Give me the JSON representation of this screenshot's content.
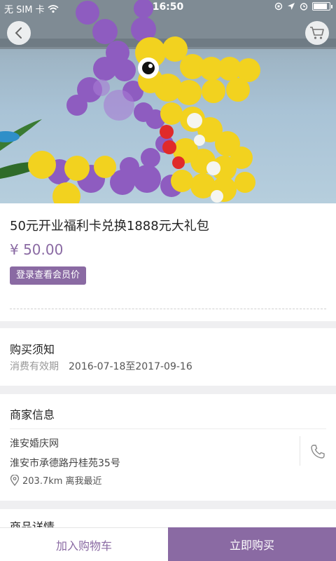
{
  "status_bar": {
    "carrier": "无 SIM 卡",
    "time": "16:50",
    "battery_level": 0.9
  },
  "header": {
    "back_icon": "chevron-left-icon",
    "cart_icon": "shopping-cart-icon"
  },
  "hero": {
    "image": "balloon-giraffe-photo"
  },
  "product": {
    "title": "50元开业福利卡兑换1888元大礼包",
    "price": "¥ 50.00",
    "member_price_button": "登录查看会员价"
  },
  "purchase_notice": {
    "title": "购买须知",
    "validity_label": "消费有效期",
    "validity_value": "2016-07-18至2017-09-16"
  },
  "merchant": {
    "title": "商家信息",
    "name": "淮安婚庆网",
    "address": "淮安市承德路丹桂苑35号",
    "distance": "203.7km 离我最近",
    "location_icon": "location-pin-icon",
    "phone_icon": "phone-icon"
  },
  "details": {
    "title": "商品详情"
  },
  "bottom_bar": {
    "add_to_cart": "加入购物车",
    "buy_now": "立即购买"
  },
  "colors": {
    "accent": "#8a6aa3"
  }
}
